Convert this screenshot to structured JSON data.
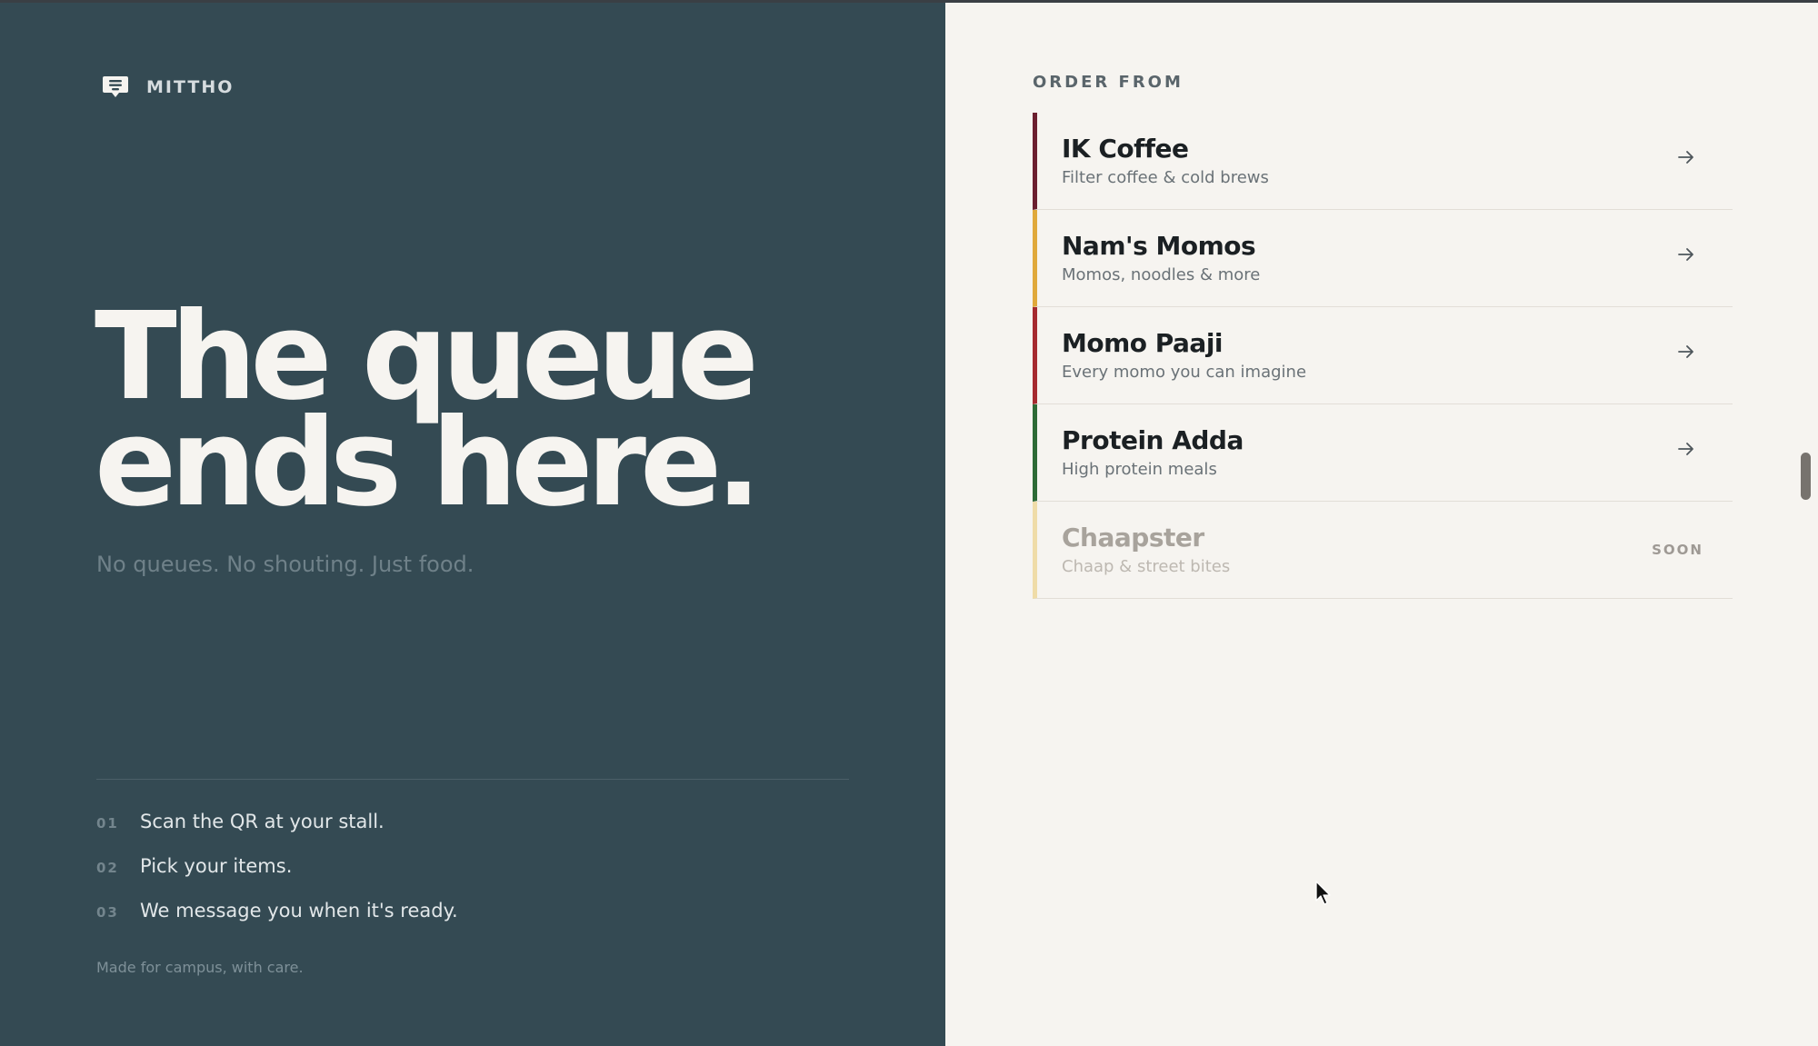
{
  "brand": {
    "name": "MITTHO",
    "icon": "chat-menu-icon"
  },
  "hero": {
    "headline_line1": "The queue",
    "headline_line2": "ends here.",
    "tagline": "No queues. No shouting. Just food."
  },
  "steps": [
    {
      "num": "01",
      "text": "Scan the QR at your stall."
    },
    {
      "num": "02",
      "text": "Pick your items."
    },
    {
      "num": "03",
      "text": "We message you when it's ready."
    }
  ],
  "footnote": "Made for campus, with care.",
  "order": {
    "label": "ORDER FROM",
    "stalls": [
      {
        "name": "IK Coffee",
        "desc": "Filter coffee & cold brews",
        "accent": "#6b1f2f",
        "status": "open",
        "icon": "arrow-right-icon"
      },
      {
        "name": "Nam's Momos",
        "desc": "Momos, noodles & more",
        "accent": "#e0a93b",
        "status": "open",
        "icon": "arrow-right-icon"
      },
      {
        "name": "Momo Paaji",
        "desc": "Every momo you can imagine",
        "accent": "#a52a2f",
        "status": "open",
        "icon": "arrow-right-icon"
      },
      {
        "name": "Protein Adda",
        "desc": "High protein meals",
        "accent": "#2d6a36",
        "status": "open",
        "icon": "arrow-right-icon"
      },
      {
        "name": "Chaapster",
        "desc": "Chaap & street bites",
        "accent": "#efdca8",
        "status": "soon",
        "badge": "SOON"
      }
    ]
  },
  "colors": {
    "left_bg": "#344a53",
    "right_bg": "#f6f4f0"
  }
}
